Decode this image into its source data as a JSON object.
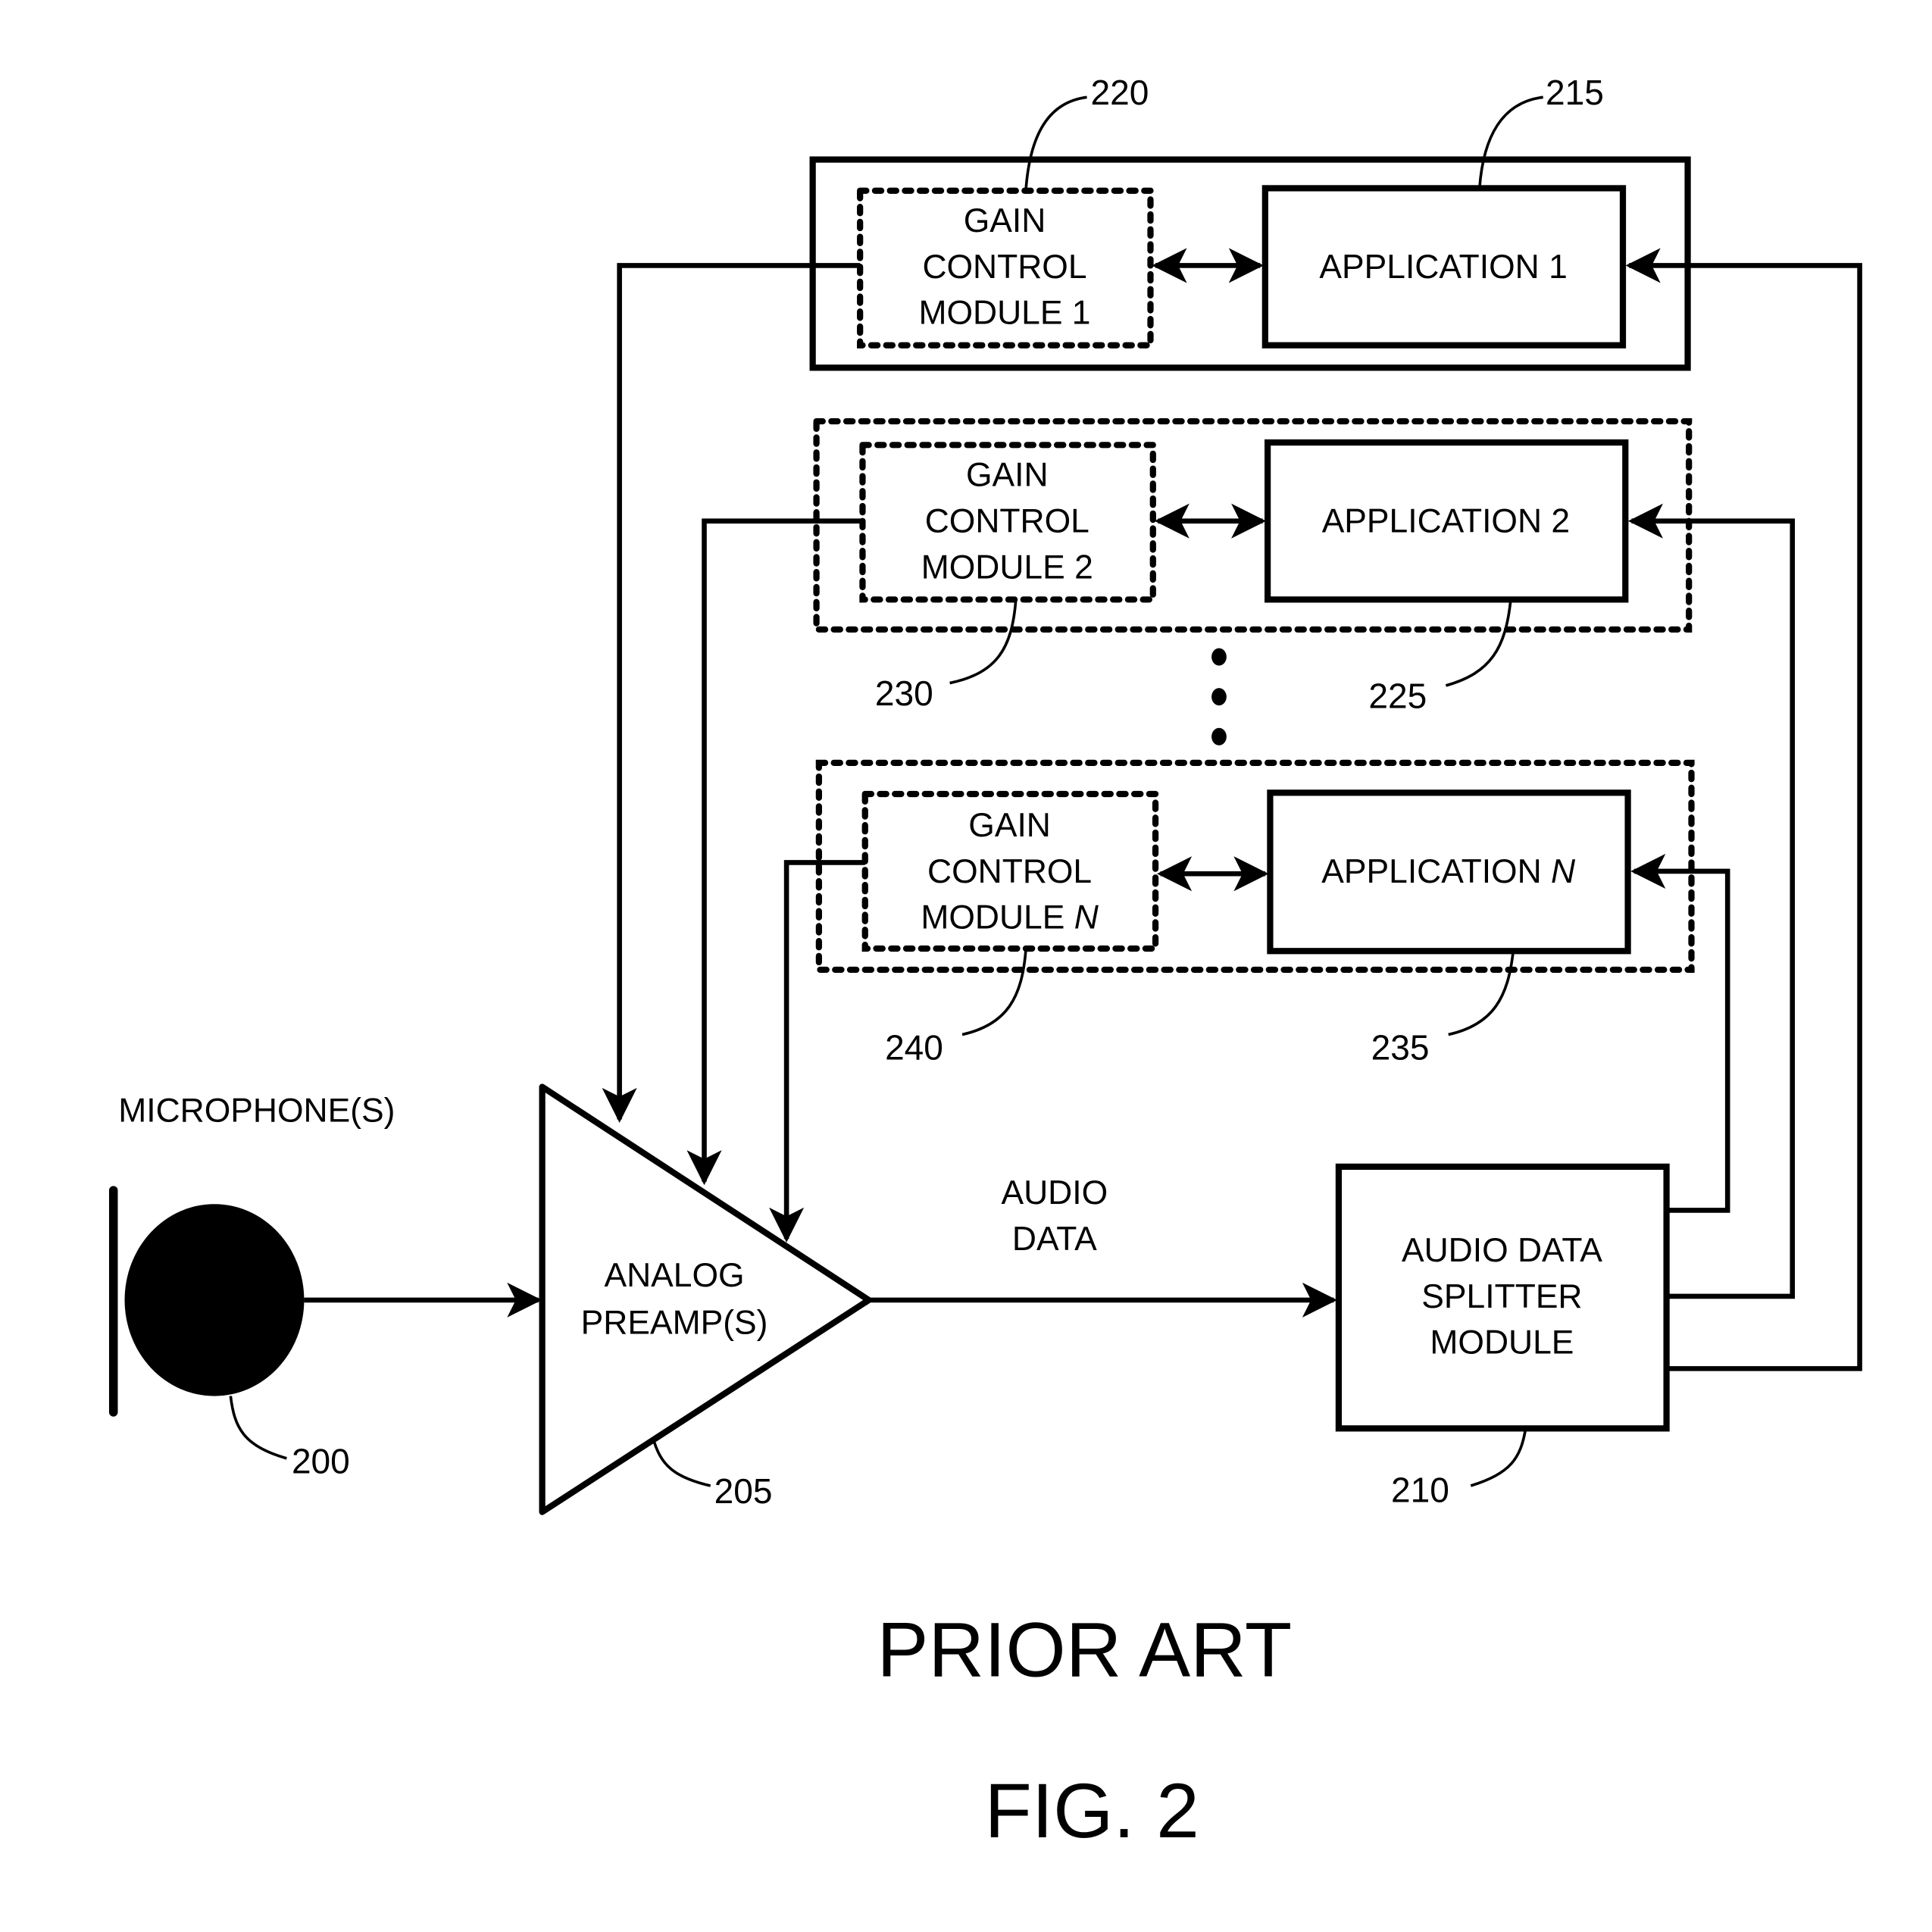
{
  "figure": {
    "caption": "FIG. 2",
    "subtitle": "PRIOR ART"
  },
  "microphone": {
    "label": "MICROPHONE(S)",
    "ref": "200"
  },
  "preamp": {
    "lines": [
      "ANALOG",
      "PREAMP(S)"
    ],
    "ref": "205"
  },
  "audio_data_label": [
    "AUDIO",
    "DATA"
  ],
  "splitter": {
    "lines": [
      "AUDIO DATA",
      "SPLITTER",
      "MODULE"
    ],
    "ref": "210"
  },
  "groups": [
    {
      "gain": {
        "lines": [
          "GAIN",
          "CONTROL",
          "MODULE 1"
        ],
        "ref": "220"
      },
      "app": {
        "label": "APPLICATION 1",
        "ref": "215"
      },
      "outer_style": "solid"
    },
    {
      "gain": {
        "lines": [
          "GAIN",
          "CONTROL",
          "MODULE 2"
        ],
        "ref": "230"
      },
      "app": {
        "label": "APPLICATION 2",
        "ref": "225"
      },
      "outer_style": "dotted"
    },
    {
      "gain": {
        "lines": [
          "GAIN",
          "CONTROL",
          "MODULE N"
        ],
        "ref": "240"
      },
      "app": {
        "label": "APPLICATION N",
        "ref": "235"
      },
      "outer_style": "dotted"
    }
  ],
  "ellipsis": "vertical-ellipsis"
}
